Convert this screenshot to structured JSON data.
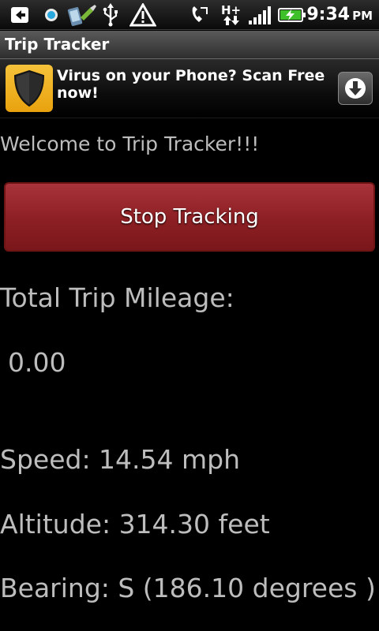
{
  "status_bar": {
    "time": "9:34",
    "ampm": "PM",
    "network_label": "H+",
    "icons": [
      "back-arrow-icon",
      "circle-notification-icon",
      "app-install-icon",
      "usb-icon",
      "warning-icon",
      "no-signal-phone-icon",
      "network-hplus-icon",
      "signal-bars-icon",
      "battery-charging-icon"
    ]
  },
  "app": {
    "title": "Trip Tracker"
  },
  "ad": {
    "text": "Virus on your Phone? Scan Free now!",
    "logo_icon": "shield-icon",
    "download_icon": "download-icon"
  },
  "main": {
    "welcome": "Welcome to Trip Tracker!!!",
    "stop_button_label": "Stop Tracking",
    "mileage_label": "Total Trip Mileage:",
    "mileage_value": "0.00",
    "speed": "Speed: 14.54 mph",
    "altitude": "Altitude: 314.30 feet",
    "bearing": "Bearing: S (186.10 degrees )"
  },
  "colors": {
    "background": "#000000",
    "button": "#8c1f23",
    "text": "#bdbdbd"
  }
}
